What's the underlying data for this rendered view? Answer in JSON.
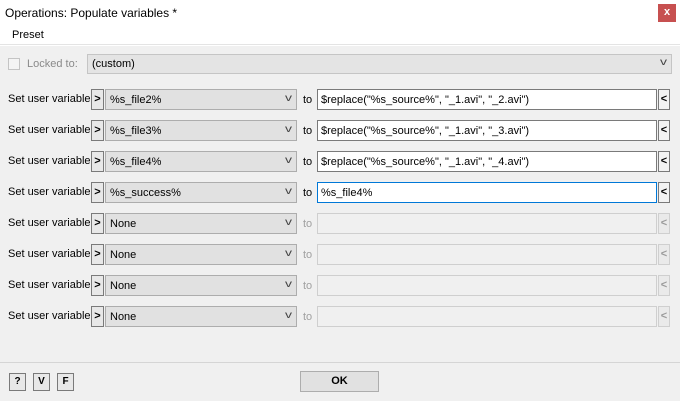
{
  "window": {
    "title": "Operations: Populate variables *",
    "close_glyph": "x"
  },
  "menu": {
    "preset_label": "Preset"
  },
  "locked": {
    "label": "Locked to:",
    "value": "(custom)",
    "checked": false
  },
  "row_label": "Set user variable",
  "to_label": "to",
  "rows": [
    {
      "variable": "%s_file2%",
      "value": "$replace(\"%s_source%\", \"_1.avi\", \"_2.avi\")"
    },
    {
      "variable": "%s_file3%",
      "value": "$replace(\"%s_source%\", \"_1.avi\", \"_3.avi\")"
    },
    {
      "variable": "%s_file4%",
      "value": "$replace(\"%s_source%\", \"_1.avi\", \"_4.avi\")"
    },
    {
      "variable": "%s_success%",
      "value": "%s_file4%"
    },
    {
      "variable": "None",
      "value": ""
    },
    {
      "variable": "None",
      "value": ""
    },
    {
      "variable": "None",
      "value": ""
    },
    {
      "variable": "None",
      "value": ""
    }
  ],
  "glyphs": {
    "expand": ">",
    "collapse": "<",
    "dropdown": "v"
  },
  "bottom": {
    "help_label": "?",
    "v_label": "V",
    "f_label": "F",
    "ok_label": "OK"
  },
  "colors": {
    "focus_border": "#0078d7",
    "close_bg": "#c75050"
  },
  "icons": [
    "close-icon",
    "chevron-down-icon",
    "expand-arrow-icon",
    "collapse-arrow-icon",
    "help-icon"
  ]
}
